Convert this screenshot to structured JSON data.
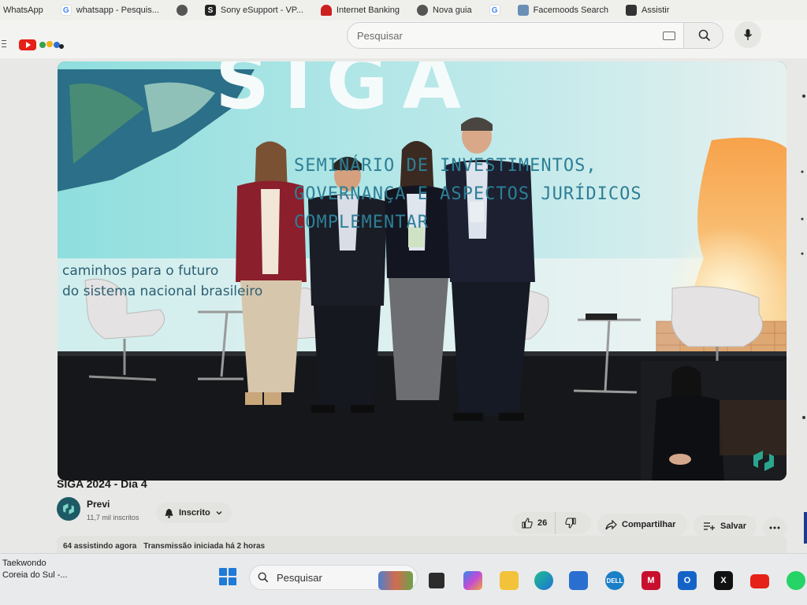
{
  "bookmarks": [
    {
      "label": "WhatsApp",
      "icon": "whatsapp-icon"
    },
    {
      "label": "whatsapp - Pesquis...",
      "icon": "google-icon"
    },
    {
      "label": "",
      "icon": "globe-icon"
    },
    {
      "label": "Sony eSupport - VP...",
      "icon": "sony-icon"
    },
    {
      "label": "Internet Banking",
      "icon": "bank-icon"
    },
    {
      "label": "Nova guia",
      "icon": "globe-icon"
    },
    {
      "label": "",
      "icon": "google-icon"
    },
    {
      "label": "Facemoods Search",
      "icon": "facemoods-icon"
    },
    {
      "label": "Assistir",
      "icon": "bookmark-icon"
    }
  ],
  "youtube": {
    "search_placeholder": "Pesquisar"
  },
  "video": {
    "banner_title": "SIGA",
    "banner_lines": [
      "SEMINÁRIO DE INVESTIMENTOS,",
      "GOVERNANÇA E ASPECTOS JURÍDICOS",
      "COMPLEMENTAR"
    ],
    "banner_sub_1": "caminhos para o futuro",
    "banner_sub_2": "do sistema nacional brasileiro",
    "title": "SIGA 2024 - Dia 4"
  },
  "channel": {
    "name": "Previ",
    "subscribers": "11,7 mil inscritos",
    "subscribe_label": "Inscrito"
  },
  "actions": {
    "likes": "26",
    "share_label": "Compartilhar",
    "save_label": "Salvar"
  },
  "description": {
    "watching": "64 assistindo agora",
    "started": "Transmissão iniciada há 2 horas"
  },
  "taskbar": {
    "weather_line1": "Taekwondo",
    "weather_line2": "Coreia do Sul -...",
    "search_placeholder": "Pesquisar",
    "apps": [
      "widgets-icon",
      "task-view-icon",
      "copilot-icon",
      "file-explorer-icon",
      "edge-icon",
      "store-icon",
      "dell-icon",
      "mcafee-icon",
      "outlook-icon",
      "x-icon",
      "youtube-icon",
      "whatsapp-icon"
    ]
  },
  "colors": {
    "youtube_red": "#e62117",
    "stage_cyan": "#7fd6d6",
    "banner_text": "#2d7f97",
    "windows_blue": "#1f7ad8"
  }
}
